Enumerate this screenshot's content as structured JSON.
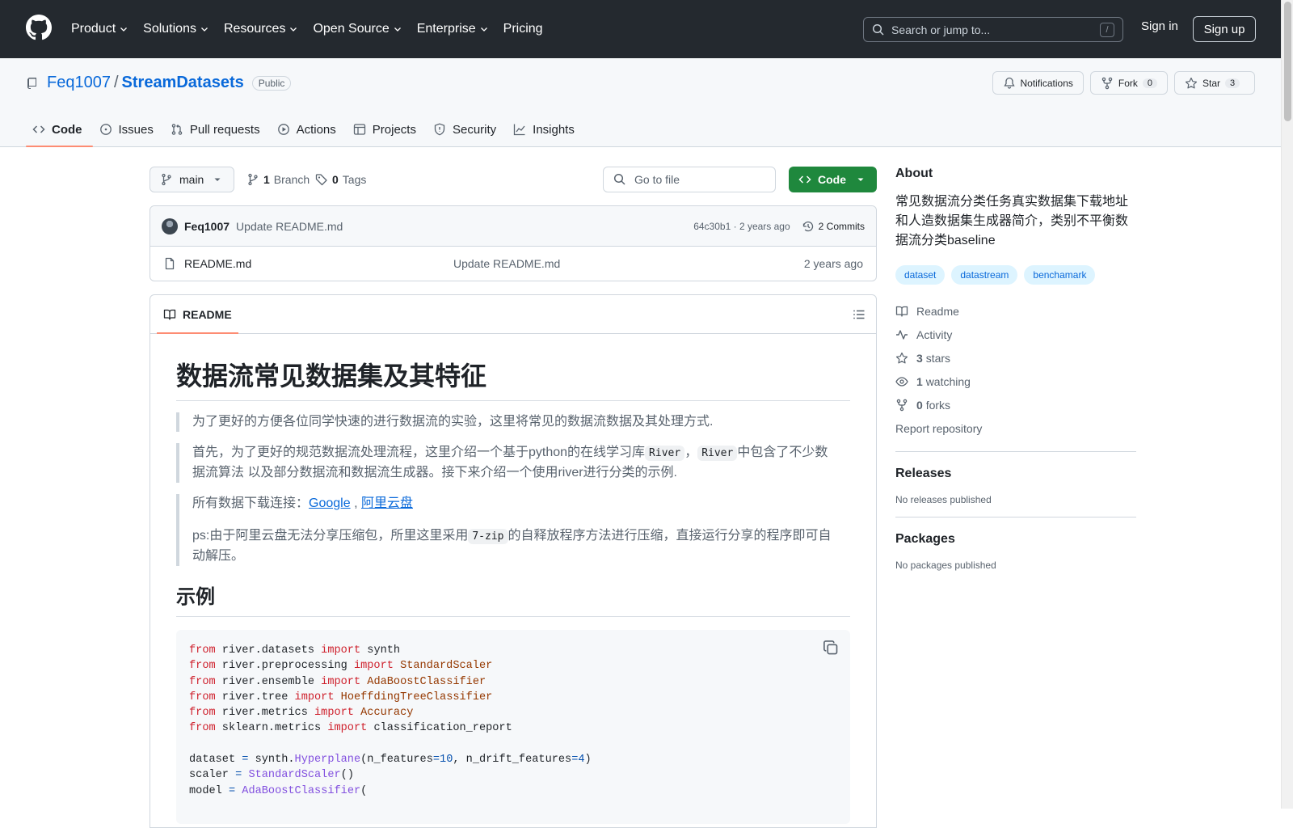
{
  "header": {
    "nav": [
      {
        "label": "Product"
      },
      {
        "label": "Solutions"
      },
      {
        "label": "Resources"
      },
      {
        "label": "Open Source"
      },
      {
        "label": "Enterprise"
      },
      {
        "label": "Pricing"
      }
    ],
    "search_placeholder": "Search or jump to...",
    "search_kbd": "/",
    "sign_in": "Sign in",
    "sign_up": "Sign up"
  },
  "repo": {
    "owner": "Feq1007",
    "slash": "/",
    "name": "StreamDatasets",
    "visibility": "Public",
    "notifications": "Notifications",
    "fork_label": "Fork",
    "fork_count": "0",
    "star_label": "Star",
    "star_count": "3",
    "tabs": [
      {
        "label": "Code"
      },
      {
        "label": "Issues"
      },
      {
        "label": "Pull requests"
      },
      {
        "label": "Actions"
      },
      {
        "label": "Projects"
      },
      {
        "label": "Security"
      },
      {
        "label": "Insights"
      }
    ]
  },
  "toolbar": {
    "branch": "main",
    "branch_count": "1",
    "branch_label": "Branch",
    "tag_count": "0",
    "tag_label": "Tags",
    "goto_placeholder": "Go to file",
    "code_button": "Code"
  },
  "commit": {
    "author": "Feq1007",
    "message": "Update README.md",
    "sha": "64c30b1",
    "sep": "·",
    "time": "2 years ago",
    "commits": "2 Commits"
  },
  "files": [
    {
      "name": "README.md",
      "message": "Update README.md",
      "date": "2 years ago"
    }
  ],
  "readme": {
    "tab": "README",
    "h1": "数据流常见数据集及其特征",
    "q1": "为了更好的方便各位同学快速的进行数据流的实验，这里将常见的数据流数据及其处理方式.",
    "q2_a": "首先，为了更好的规范数据流处理流程，这里介绍一个基于python的在线学习库",
    "q2_code1": "River",
    "q2_b": "，",
    "q2_code2": "River",
    "q2_c": "中包含了不少数据流算法 以及部分数据流和数据流生成器。接下来介绍一个使用river进行分类的示例.",
    "q3_a": "所有数据下载连接：",
    "q3_link1": "Google",
    "q3_sep": ",",
    "q3_link2": "阿里云盘",
    "q3_b": "ps:由于阿里云盘无法分享压缩包，所里这里采用",
    "q3_code": "7-zip",
    "q3_c": "的自释放程序方法进行压缩，直接运行分享的程序即可自动解压。",
    "h2": "示例",
    "code_lines": [
      [
        {
          "t": "from",
          "c": "k"
        },
        {
          "t": " river.datasets ",
          "c": ""
        },
        {
          "t": "import",
          "c": "k"
        },
        {
          "t": " synth",
          "c": ""
        }
      ],
      [
        {
          "t": "from",
          "c": "k"
        },
        {
          "t": " river.preprocessing ",
          "c": ""
        },
        {
          "t": "import",
          "c": "k"
        },
        {
          "t": " ",
          "c": ""
        },
        {
          "t": "StandardScaler",
          "c": "c"
        }
      ],
      [
        {
          "t": "from",
          "c": "k"
        },
        {
          "t": " river.ensemble ",
          "c": ""
        },
        {
          "t": "import",
          "c": "k"
        },
        {
          "t": " ",
          "c": ""
        },
        {
          "t": "AdaBoostClassifier",
          "c": "c"
        }
      ],
      [
        {
          "t": "from",
          "c": "k"
        },
        {
          "t": " river.tree ",
          "c": ""
        },
        {
          "t": "import",
          "c": "k"
        },
        {
          "t": " ",
          "c": ""
        },
        {
          "t": "HoeffdingTreeClassifier",
          "c": "c"
        }
      ],
      [
        {
          "t": "from",
          "c": "k"
        },
        {
          "t": " river.metrics ",
          "c": ""
        },
        {
          "t": "import",
          "c": "k"
        },
        {
          "t": " ",
          "c": ""
        },
        {
          "t": "Accuracy",
          "c": "c"
        }
      ],
      [
        {
          "t": "from",
          "c": "k"
        },
        {
          "t": " sklearn.metrics ",
          "c": ""
        },
        {
          "t": "import",
          "c": "k"
        },
        {
          "t": " classification_report",
          "c": ""
        }
      ],
      [],
      [
        {
          "t": "dataset ",
          "c": ""
        },
        {
          "t": "=",
          "c": "n"
        },
        {
          "t": " synth.",
          "c": ""
        },
        {
          "t": "Hyperplane",
          "c": "f"
        },
        {
          "t": "(n_features",
          "c": ""
        },
        {
          "t": "=",
          "c": "n"
        },
        {
          "t": "10",
          "c": "n"
        },
        {
          "t": ", n_drift_features",
          "c": ""
        },
        {
          "t": "=",
          "c": "n"
        },
        {
          "t": "4",
          "c": "n"
        },
        {
          "t": ")",
          "c": ""
        }
      ],
      [
        {
          "t": "scaler ",
          "c": ""
        },
        {
          "t": "=",
          "c": "n"
        },
        {
          "t": " ",
          "c": ""
        },
        {
          "t": "StandardScaler",
          "c": "f"
        },
        {
          "t": "()",
          "c": ""
        }
      ],
      [
        {
          "t": "model ",
          "c": ""
        },
        {
          "t": "=",
          "c": "n"
        },
        {
          "t": " ",
          "c": ""
        },
        {
          "t": "AdaBoostClassifier",
          "c": "f"
        },
        {
          "t": "(",
          "c": ""
        }
      ]
    ]
  },
  "about": {
    "title": "About",
    "description": "常见数据流分类任务真实数据集下载地址和人造数据集生成器简介，类别不平衡数据流分类baseline",
    "topics": [
      "dataset",
      "datastream",
      "benchamark"
    ],
    "readme": "Readme",
    "activity": "Activity",
    "stars_count": "3",
    "stars_label": "stars",
    "watching_count": "1",
    "watching_label": "watching",
    "forks_count": "0",
    "forks_label": "forks",
    "report": "Report repository"
  },
  "releases": {
    "title": "Releases",
    "empty": "No releases published"
  },
  "packages": {
    "title": "Packages",
    "empty": "No packages published"
  }
}
